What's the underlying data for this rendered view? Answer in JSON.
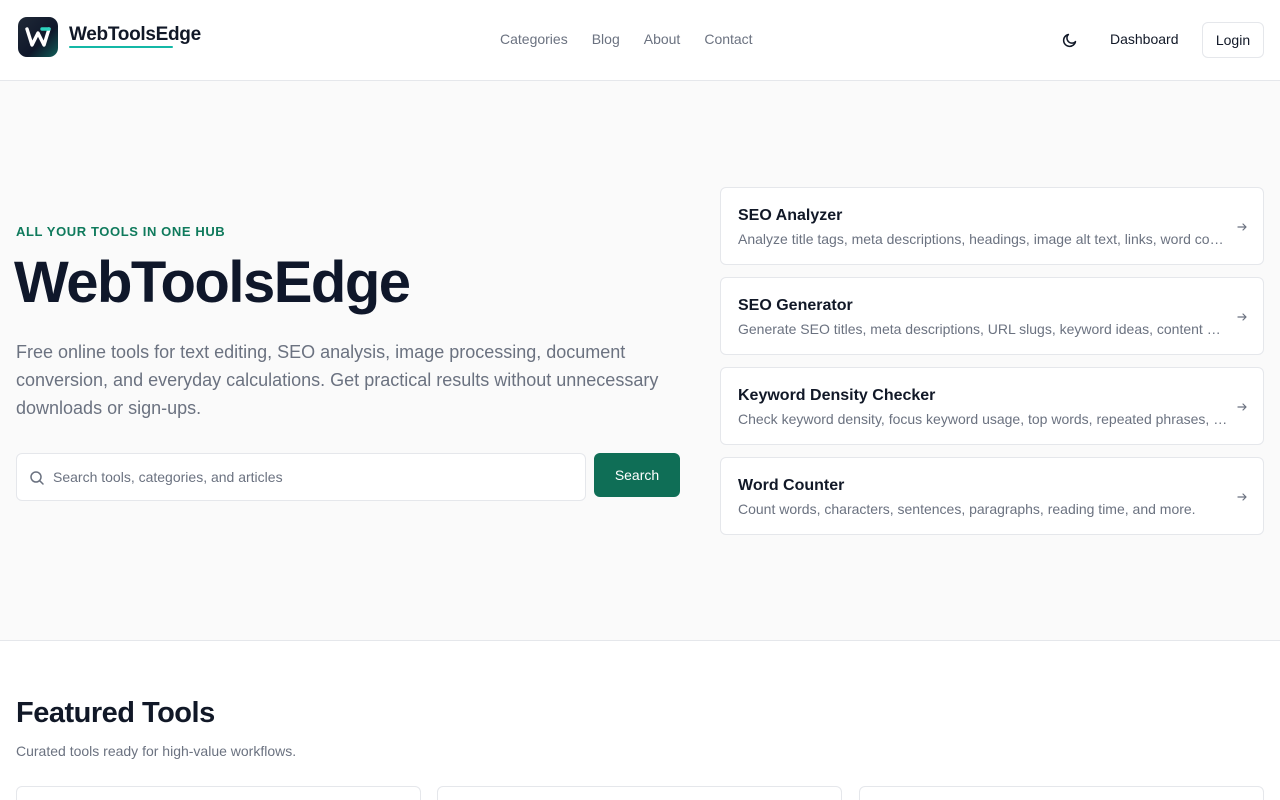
{
  "header": {
    "brand": "WebToolsEdge",
    "nav": [
      "Categories",
      "Blog",
      "About",
      "Contact"
    ],
    "dashboard_label": "Dashboard",
    "login_label": "Login"
  },
  "hero": {
    "eyebrow": "ALL YOUR TOOLS IN ONE HUB",
    "title": "WebToolsEdge",
    "description": "Free online tools for text editing, SEO analysis, image processing, document conversion, and everyday calculations. Get practical results without unnecessary downloads or sign-ups.",
    "search_placeholder": "Search tools, categories, and articles",
    "search_button": "Search"
  },
  "tools": [
    {
      "title": "SEO Analyzer",
      "description": "Analyze title tags, meta descriptions, headings, image alt text, links, word count, and more."
    },
    {
      "title": "SEO Generator",
      "description": "Generate SEO titles, meta descriptions, URL slugs, keyword ideas, content outlines, and more."
    },
    {
      "title": "Keyword Density Checker",
      "description": "Check keyword density, focus keyword usage, top words, repeated phrases, and more."
    },
    {
      "title": "Word Counter",
      "description": "Count words, characters, sentences, paragraphs, reading time, and more."
    }
  ],
  "featured": {
    "title": "Featured Tools",
    "subtitle": "Curated tools ready for high-value workflows."
  },
  "colors": {
    "accent": "#0f6e56",
    "eyebrow": "#0f7a5c",
    "brand_underline": "#14b8a6"
  }
}
